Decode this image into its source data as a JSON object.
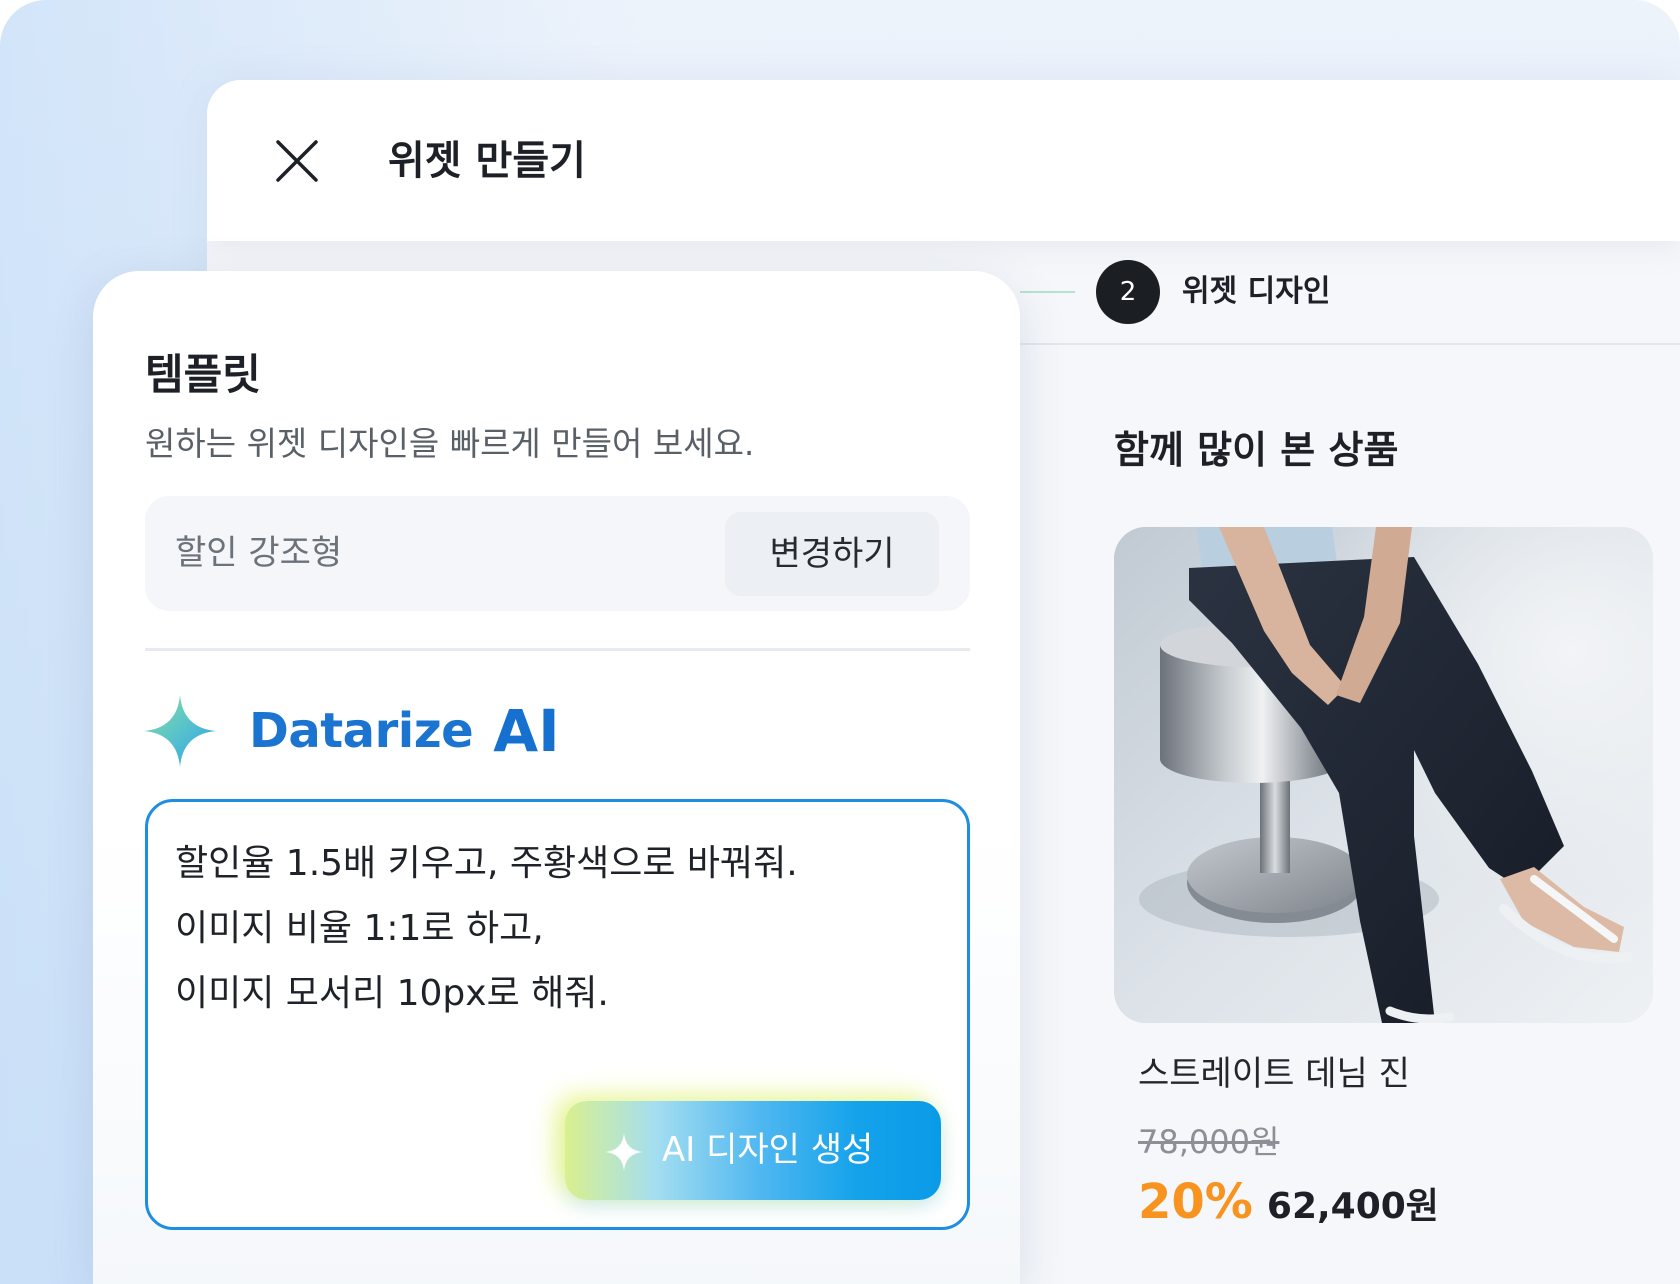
{
  "window": {
    "title": "위젯 만들기"
  },
  "stepper": {
    "current_step_number": "2",
    "current_step_label": "위젯 디자인"
  },
  "template_panel": {
    "title": "템플릿",
    "subtitle": "원하는 위젯 디자인을 빠르게 만들어 보세요.",
    "selected_template": "할인 강조형",
    "change_button_label": "변경하기"
  },
  "ai_panel": {
    "brand_name": "Datarize",
    "brand_suffix": "AI",
    "prompt_value": "할인율 1.5배 키우고, 주황색으로 바꿔줘.\n이미지 비율 1:1로 하고,\n이미지 모서리 10px로 해줘.",
    "generate_button_label": "AI 디자인 생성"
  },
  "preview": {
    "section_title": "함께 많이 본 상품",
    "product": {
      "name": "스트레이트 데님 진",
      "original_price": "78,000원",
      "discount_rate": "20%",
      "sale_price": "62,400원"
    }
  },
  "icons": {
    "close": "close-icon",
    "ai_logo": "sparkle-icon",
    "generate_button": "sparkle-icon"
  },
  "colors": {
    "brand_blue": "#1a74d0",
    "prompt_border": "#1d8ee2",
    "generate_button": "#0a9be8",
    "discount_orange": "#f7931e",
    "step_active": "#1b1e23",
    "step_connector": "#b6e2cc"
  }
}
